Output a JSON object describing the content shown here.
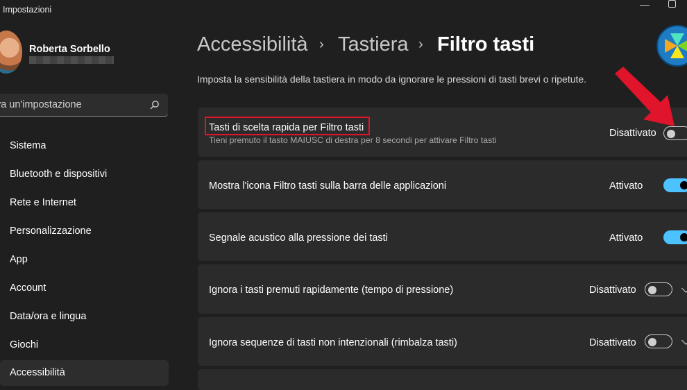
{
  "window": {
    "title": "Impostazioni"
  },
  "user": {
    "name": "Roberta Sorbello"
  },
  "search": {
    "placeholder": "va un'impostazione"
  },
  "nav": [
    {
      "label": "Sistema"
    },
    {
      "label": "Bluetooth e dispositivi"
    },
    {
      "label": "Rete e Internet"
    },
    {
      "label": "Personalizzazione"
    },
    {
      "label": "App"
    },
    {
      "label": "Account"
    },
    {
      "label": "Data/ora e lingua"
    },
    {
      "label": "Giochi"
    },
    {
      "label": "Accessibilità",
      "selected": true
    }
  ],
  "breadcrumb": {
    "level1": "Accessibilità",
    "level2": "Tastiera",
    "current": "Filtro tasti",
    "separator": "›"
  },
  "description": "Imposta la sensibilità della tastiera in modo da ignorare le pressioni di tasti brevi o ripetute.",
  "settings": [
    {
      "title": "Tasti di scelta rapida per Filtro tasti",
      "subtitle": "Tieni premuto il tasto MAIUSC di destra per 8 secondi per attivare Filtro tasti",
      "state": "Disattivato",
      "on": false,
      "expandable": false,
      "highlighted": true
    },
    {
      "title": "Mostra l'icona Filtro tasti sulla barra delle applicazioni",
      "state": "Attivato",
      "on": true,
      "expandable": false
    },
    {
      "title": "Segnale acustico alla pressione dei tasti",
      "state": "Attivato",
      "on": true,
      "expandable": false
    },
    {
      "title": "Ignora i tasti premuti rapidamente (tempo di pressione)",
      "state": "Disattivato",
      "on": false,
      "expandable": true
    },
    {
      "title": "Ignora sequenze di tasti non intenzionali (rimbalza tasti)",
      "state": "Disattivato",
      "on": false,
      "expandable": true
    }
  ],
  "colors": {
    "accent": "#4cc2ff",
    "annotation": "#e0142a",
    "background": "#1f1f1f",
    "card": "#2b2b2b"
  },
  "icons": {
    "search": "search-icon",
    "annotation_arrow": "red-arrow-icon",
    "logo": "channel-logo"
  }
}
